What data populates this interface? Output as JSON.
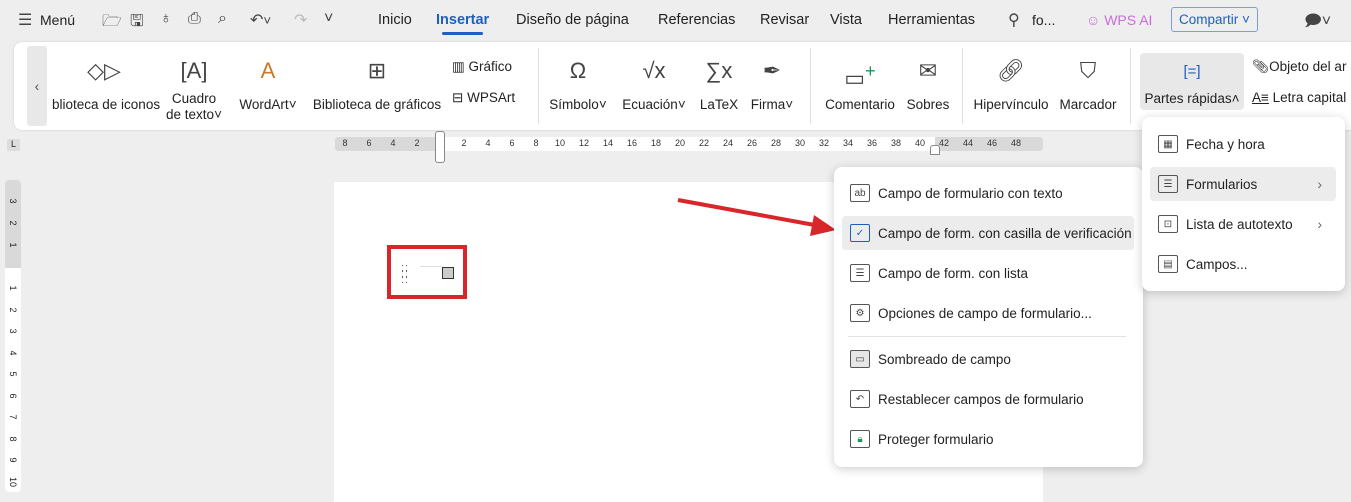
{
  "topbar": {
    "menu_label": "Menú",
    "tabs": [
      "Inicio",
      "Insertar",
      "Diseño de página",
      "Referencias",
      "Revisar",
      "Vista",
      "Herramientas"
    ],
    "active_tab": "Insertar",
    "search_text": "fo...",
    "wps_ai": "WPS AI",
    "share": "Compartir"
  },
  "ribbon": {
    "icon_library": "blioteca de iconos",
    "textbox_line1": "Cuadro",
    "textbox_line2": "de texto",
    "wordart": "WordArt",
    "chart_library": "Biblioteca de gráficos",
    "chart": "Gráfico",
    "wpsart": "WPSArt",
    "symbol": "Símbolo",
    "equation": "Ecuación",
    "latex": "LaTeX",
    "signature": "Firma",
    "comment": "Comentario",
    "envelopes": "Sobres",
    "hyperlink": "Hipervínculo",
    "bookmark": "Marcador",
    "quick_parts": "Partes rápidas",
    "object": "Objeto del ar",
    "drop_cap": "Letra capital"
  },
  "ruler": {
    "h_ticks": [
      "8",
      "6",
      "4",
      "2",
      "2",
      "4",
      "6",
      "8",
      "10",
      "12",
      "14",
      "16",
      "18",
      "20",
      "22",
      "24",
      "26",
      "28",
      "30",
      "32",
      "34",
      "36",
      "38",
      "40",
      "42",
      "44",
      "46",
      "48"
    ],
    "v_ticks": [
      "3",
      "2",
      "1",
      "1",
      "2",
      "3",
      "4",
      "5",
      "6",
      "7",
      "8",
      "9",
      "10"
    ]
  },
  "menu": {
    "items": [
      "Campo de formulario con texto",
      "Campo de form. con casilla de verificación",
      "Campo de form. con lista",
      "Opciones de campo de formulario...",
      "Sombreado de campo",
      "Restablecer campos de formulario",
      "Proteger formulario"
    ],
    "highlighted": 1
  },
  "submenu": {
    "items": [
      "Fecha y hora",
      "Formularios",
      "Lista de autotexto",
      "Campos..."
    ]
  },
  "colors": {
    "accent": "#1f5fbf",
    "annotation": "#d9262b",
    "wps_ai": "#c86fd6"
  }
}
